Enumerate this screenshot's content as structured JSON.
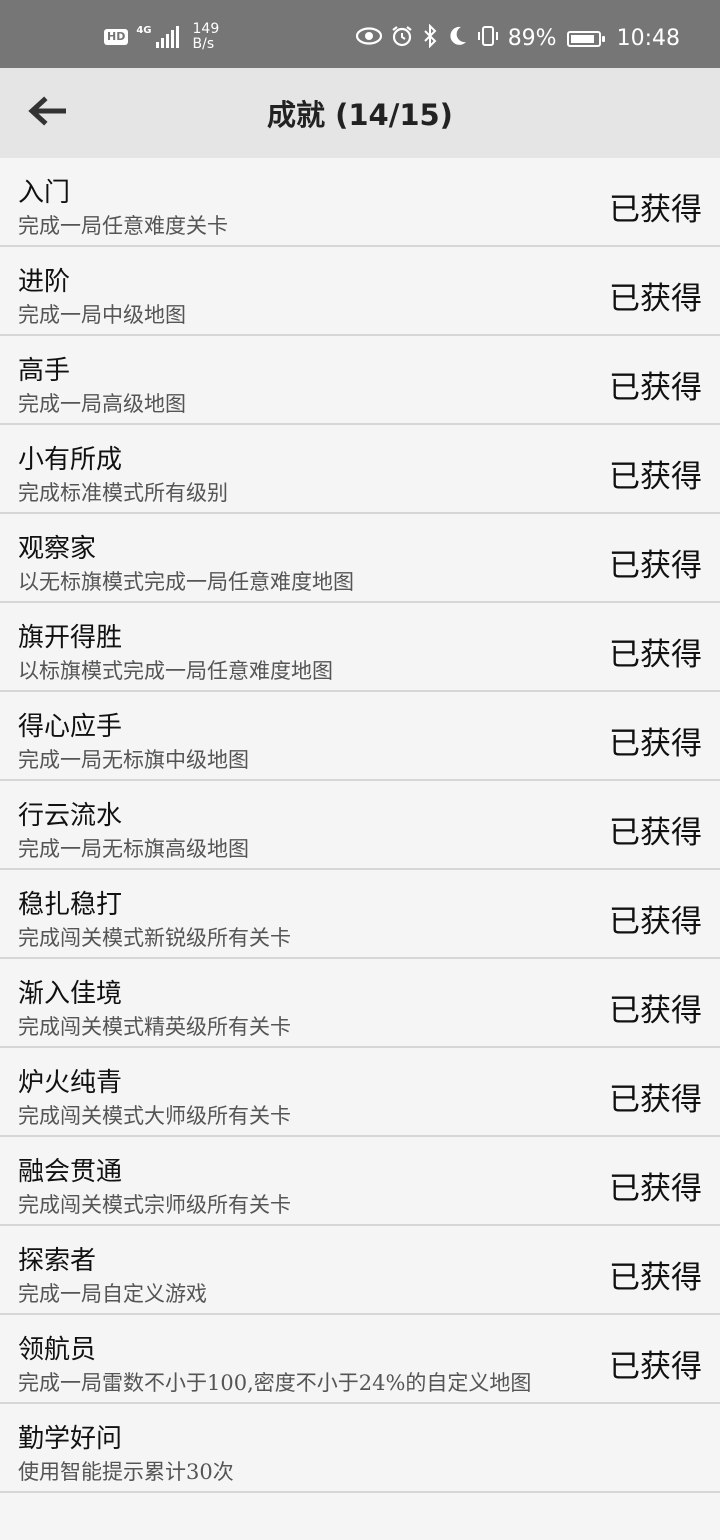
{
  "status_bar": {
    "network_badge": "HD",
    "network_type": "4G",
    "speed_value": "149",
    "speed_unit": "B/s",
    "battery_percent": "89%",
    "battery_level": 0.89,
    "time": "10:48",
    "icons": [
      "eye-icon",
      "alarm-icon",
      "bluetooth-icon",
      "moon-icon",
      "vibrate-icon"
    ]
  },
  "header": {
    "title": "成就 (14/15)",
    "back_icon": "arrow-left-icon"
  },
  "achievements": [
    {
      "name": "入门",
      "desc": "完成一局任意难度关卡",
      "status": "已获得"
    },
    {
      "name": "进阶",
      "desc": "完成一局中级地图",
      "status": "已获得"
    },
    {
      "name": "高手",
      "desc": "完成一局高级地图",
      "status": "已获得"
    },
    {
      "name": "小有所成",
      "desc": "完成标准模式所有级别",
      "status": "已获得"
    },
    {
      "name": "观察家",
      "desc": "以无标旗模式完成一局任意难度地图",
      "status": "已获得"
    },
    {
      "name": "旗开得胜",
      "desc": "以标旗模式完成一局任意难度地图",
      "status": "已获得"
    },
    {
      "name": "得心应手",
      "desc": "完成一局无标旗中级地图",
      "status": "已获得"
    },
    {
      "name": "行云流水",
      "desc": "完成一局无标旗高级地图",
      "status": "已获得"
    },
    {
      "name": "稳扎稳打",
      "desc": "完成闯关模式新锐级所有关卡",
      "status": "已获得"
    },
    {
      "name": "渐入佳境",
      "desc": "完成闯关模式精英级所有关卡",
      "status": "已获得"
    },
    {
      "name": "炉火纯青",
      "desc": "完成闯关模式大师级所有关卡",
      "status": "已获得"
    },
    {
      "name": "融会贯通",
      "desc": "完成闯关模式宗师级所有关卡",
      "status": "已获得"
    },
    {
      "name": "探索者",
      "desc": "完成一局自定义游戏",
      "status": "已获得"
    },
    {
      "name": "领航员",
      "desc": "完成一局雷数不小于100,密度不小于24%的自定义地图",
      "status": "已获得"
    },
    {
      "name": "勤学好问",
      "desc": "使用智能提示累计30次",
      "status": ""
    }
  ]
}
